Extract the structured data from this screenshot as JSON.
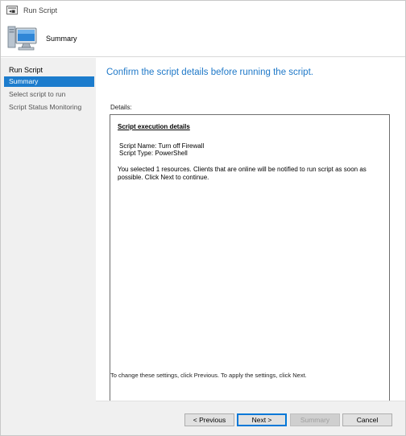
{
  "window": {
    "title": "Run Script"
  },
  "header": {
    "title": "Summary"
  },
  "nav": {
    "items": [
      {
        "label": "Run Script",
        "state": "heading"
      },
      {
        "label": "Summary",
        "state": "active"
      },
      {
        "label": "Select script to run",
        "state": "normal"
      },
      {
        "label": "Script Status Monitoring",
        "state": "normal"
      }
    ]
  },
  "main": {
    "heading": "Confirm the script details before running the script.",
    "details_label": "Details:",
    "details": {
      "title": "Script execution details",
      "script_name": "Script Name: Turn off Firewall",
      "script_type": "Script Type: PowerShell",
      "message": "You selected 1 resources. Clients that are online will be notified to run script as soon as possible. Click Next to continue."
    },
    "hint": "To change these settings, click Previous. To apply the settings, click Next."
  },
  "footer": {
    "previous_label": "< Previous",
    "next_label": "Next >",
    "summary_label": "Summary",
    "cancel_label": "Cancel"
  },
  "colors": {
    "accent": "#1e78c8",
    "nav_active": "#1c7ccd",
    "nav_background": "#f0f0f0"
  },
  "icons": {
    "title": "window-app-icon",
    "header": "computer-monitor-icon"
  }
}
